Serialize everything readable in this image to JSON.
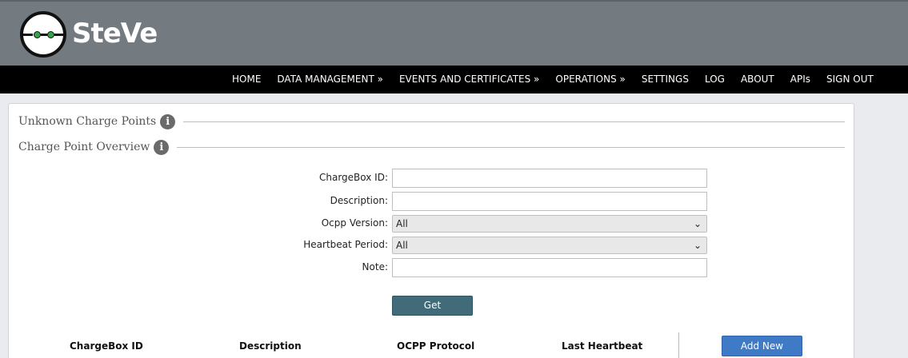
{
  "header": {
    "logo_text": "SteVe"
  },
  "nav": {
    "items": [
      "HOME",
      "DATA MANAGEMENT »",
      "EVENTS AND CERTIFICATES »",
      "OPERATIONS »",
      "SETTINGS",
      "LOG",
      "ABOUT",
      "APIs",
      "SIGN OUT"
    ]
  },
  "sections": {
    "unknown_title": "Unknown Charge Points",
    "overview_title": "Charge Point Overview",
    "info_glyph": "i"
  },
  "form": {
    "chargebox_id_label": "ChargeBox ID:",
    "chargebox_id_value": "",
    "description_label": "Description:",
    "description_value": "",
    "ocpp_version_label": "Ocpp Version:",
    "ocpp_version_value": "All",
    "heartbeat_label": "Heartbeat Period:",
    "heartbeat_value": "All",
    "note_label": "Note:",
    "note_value": "",
    "chevron": "⌄",
    "get_button": "Get"
  },
  "table": {
    "columns": [
      "ChargeBox ID",
      "Description",
      "OCPP Protocol",
      "Last Heartbeat"
    ],
    "add_button": "Add New"
  },
  "colors": {
    "header_bg": "#737a80",
    "nav_bg": "#000000",
    "get_button": "#426b79",
    "add_button": "#3f7ac7",
    "logo_eyes": "#3aa14a"
  }
}
